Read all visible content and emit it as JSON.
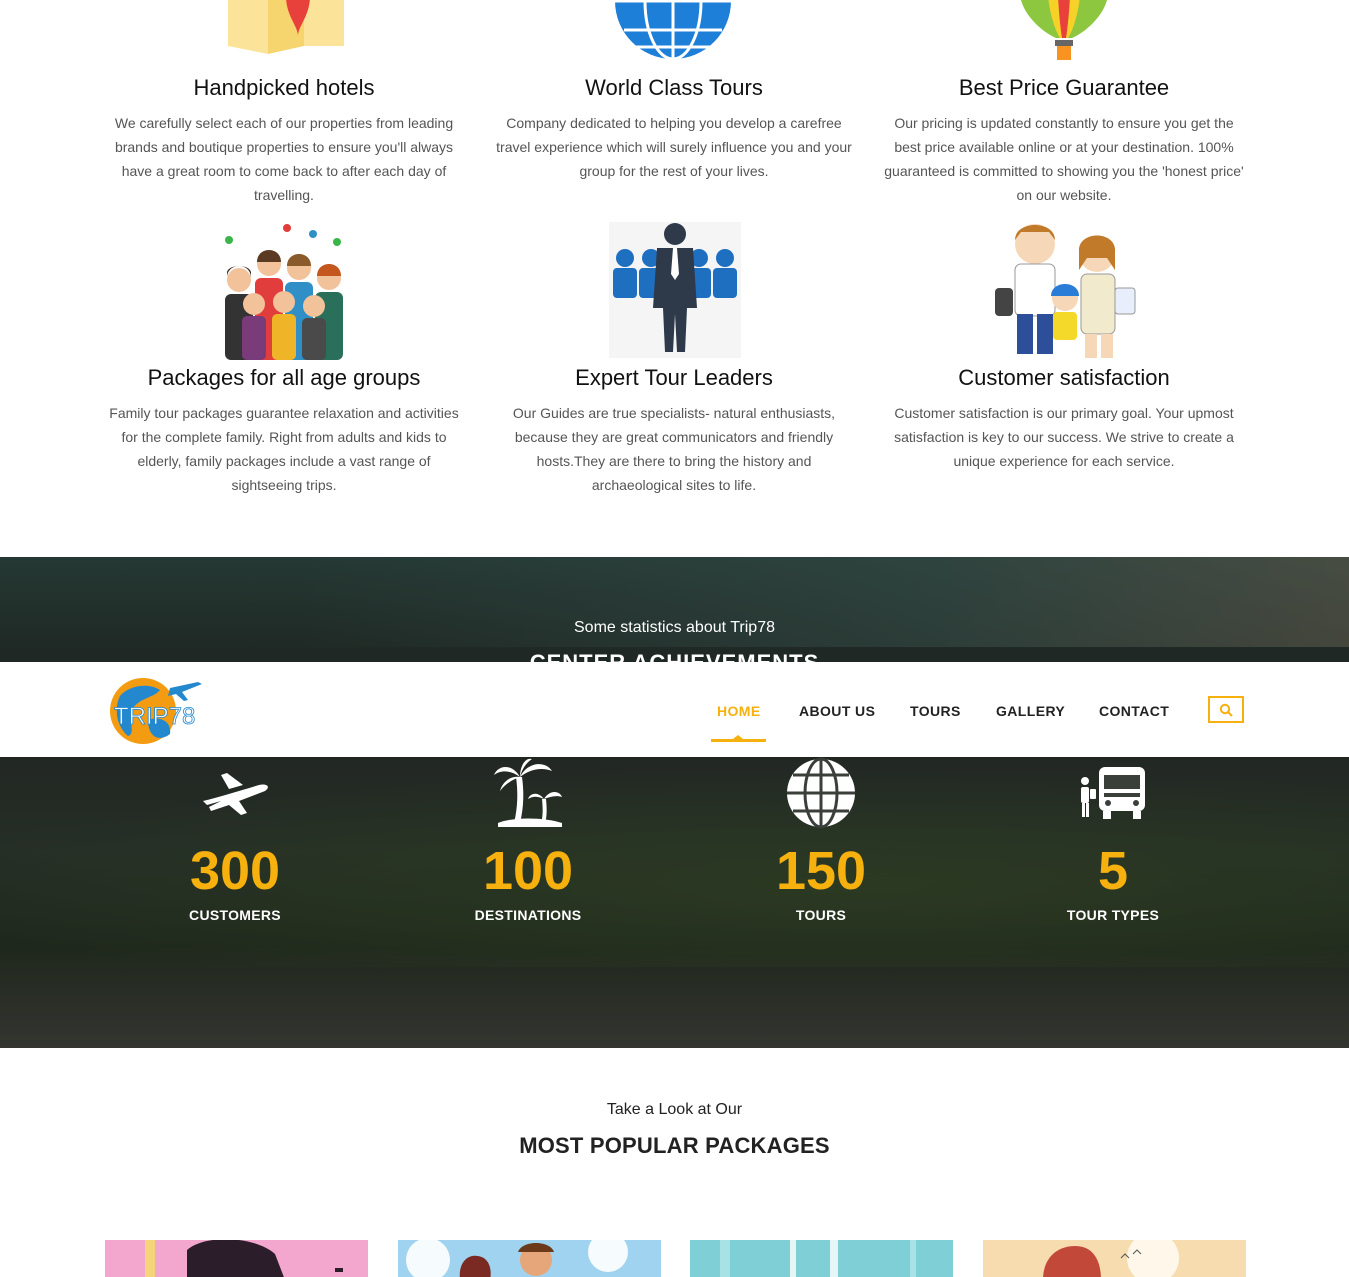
{
  "features": [
    {
      "title": "Handpicked hotels",
      "text": "We carefully select each of our properties from leading brands and boutique properties to ensure you'll always have a great room to come back to after each day of travelling.",
      "icon": "map-pin-icon"
    },
    {
      "title": "World Class Tours",
      "text": "Company dedicated to helping you develop a carefree travel experience which will surely influence you and your group for the rest of your lives.",
      "icon": "globe-icon"
    },
    {
      "title": "Best Price Guarantee",
      "text": "Our pricing is updated constantly to ensure you get the best price available online or at your destination. 100% guaranteed is committed to showing you the 'honest price' on our website.",
      "icon": "hot-air-balloon-icon"
    },
    {
      "title": "Packages for all age groups",
      "text": "Family tour packages guarantee relaxation and activities for the complete family. Right from adults and kids to elderly, family packages include a vast range of sightseeing trips.",
      "icon": "group-people-icon"
    },
    {
      "title": "Expert Tour Leaders",
      "text": "Our Guides are true specialists- natural enthusiasts, because they are great communicators and friendly hosts.They are there to bring the history and archaeological sites to life.",
      "icon": "tour-leader-icon"
    },
    {
      "title": "Customer satisfaction",
      "text": "Customer satisfaction is our primary goal. Your upmost satisfaction is key to our success. We strive to create a unique experience for each service.",
      "icon": "family-travellers-icon"
    }
  ],
  "stats": {
    "subtitle": "Some statistics about Trip78",
    "title": "CENTER ACHIEVEMENTS",
    "items": [
      {
        "value": "300",
        "label": "CUSTOMERS",
        "icon": "airplane-icon"
      },
      {
        "value": "100",
        "label": "DESTINATIONS",
        "icon": "palm-tree-icon"
      },
      {
        "value": "150",
        "label": "TOURS",
        "icon": "globe-icon"
      },
      {
        "value": "5",
        "label": "TOUR TYPES",
        "icon": "bus-icon"
      }
    ]
  },
  "nav": {
    "logo_text": "TRIP78",
    "items": [
      "HOME",
      "ABOUT US",
      "TOURS",
      "GALLERY",
      "CONTACT"
    ],
    "active": "HOME",
    "search_icon": "search-icon"
  },
  "packages": {
    "subtitle": "Take a Look at Our",
    "title": "MOST POPULAR PACKAGES"
  },
  "colors": {
    "accent": "#f6b10e",
    "text": "#222222",
    "muted": "#555555"
  }
}
